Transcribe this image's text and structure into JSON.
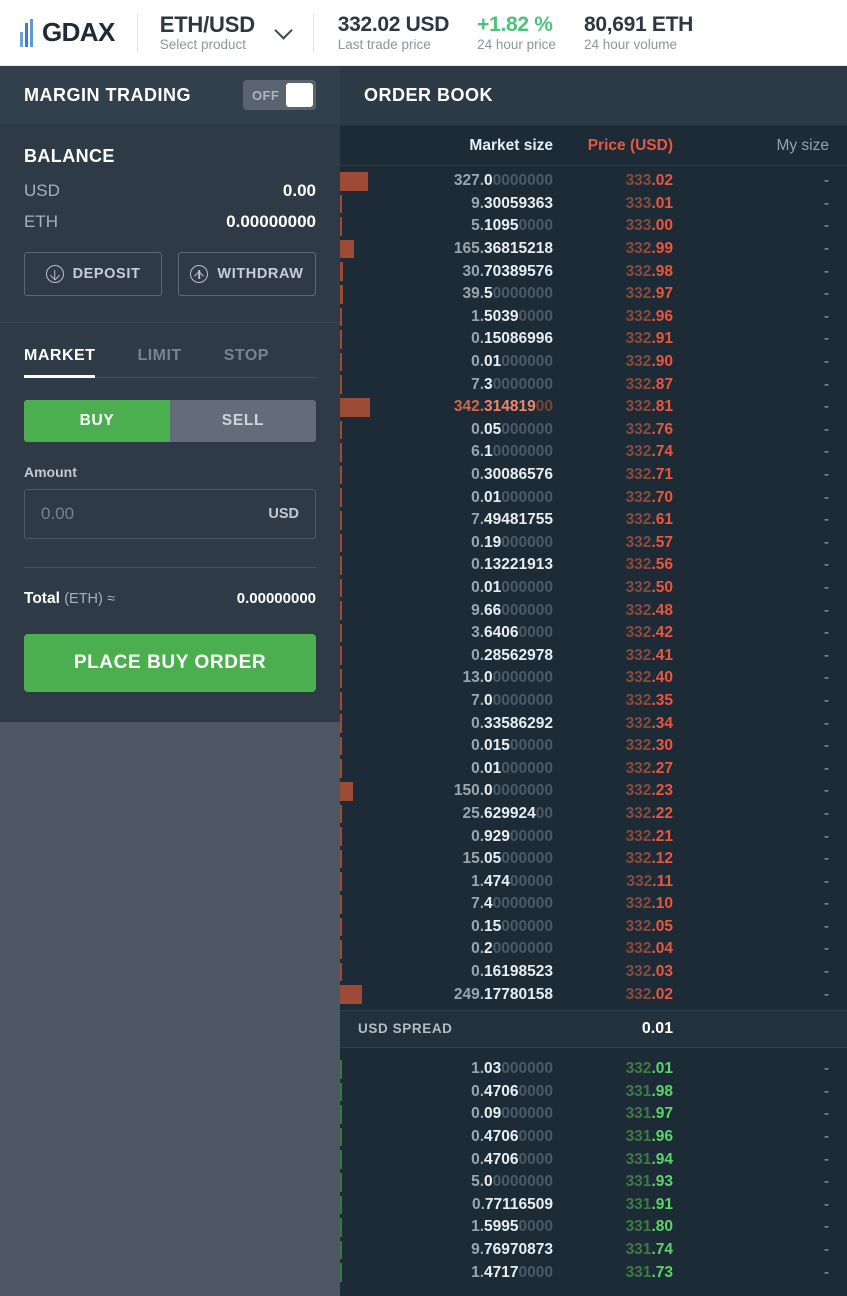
{
  "header": {
    "logo_text": "GDAX",
    "product": {
      "name": "ETH/USD",
      "sublabel": "Select product"
    },
    "stats": [
      {
        "value": "332.02 USD",
        "label": "Last trade price",
        "trend": "flat"
      },
      {
        "value": "+1.82 %",
        "label": "24 hour price",
        "trend": "up"
      },
      {
        "value": "80,691 ETH",
        "label": "24 hour volume",
        "trend": "flat"
      }
    ]
  },
  "sidebar": {
    "margin": {
      "title": "MARGIN TRADING",
      "toggle_label": "OFF",
      "toggle_state": "off"
    },
    "balance": {
      "title": "BALANCE",
      "rows": [
        {
          "currency": "USD",
          "amount": "0.00"
        },
        {
          "currency": "ETH",
          "amount": "0.00000000"
        }
      ],
      "deposit_label": "DEPOSIT",
      "withdraw_label": "WITHDRAW"
    },
    "order_form": {
      "tabs": [
        {
          "label": "MARKET",
          "active": true
        },
        {
          "label": "LIMIT",
          "active": false
        },
        {
          "label": "STOP",
          "active": false
        }
      ],
      "buy_label": "BUY",
      "sell_label": "SELL",
      "side_selected": "BUY",
      "amount_label": "Amount",
      "amount_value": "",
      "amount_placeholder": "0.00",
      "amount_unit": "USD",
      "total_label": "Total",
      "total_unit": "(ETH)",
      "total_approx": "≈",
      "total_value": "0.00000000",
      "submit_label": "PLACE BUY ORDER"
    }
  },
  "order_book": {
    "title": "ORDER BOOK",
    "columns": [
      "Market size",
      "Price (USD)",
      "My size"
    ],
    "my_size_empty": "-",
    "spread": {
      "label": "USD SPREAD",
      "value": "0.01"
    },
    "colors": {
      "ask": "#e8573f",
      "bid": "#5ed36a",
      "ask_depth": "#9d4b36",
      "bid_depth": "#2f7a3e"
    },
    "asks": [
      {
        "size": "327.00000000",
        "sig": 5,
        "price": "333.02",
        "my": "-",
        "depth": 0.131,
        "hot": false
      },
      {
        "size": "9.30059363",
        "sig": 10,
        "price": "333.01",
        "my": "-",
        "depth": 0.004,
        "hot": false
      },
      {
        "size": "5.10950000",
        "sig": 6,
        "price": "333.00",
        "my": "-",
        "depth": 0.002,
        "hot": false
      },
      {
        "size": "165.36815218",
        "sig": 12,
        "price": "332.99",
        "my": "-",
        "depth": 0.066,
        "hot": false
      },
      {
        "size": "30.70389576",
        "sig": 11,
        "price": "332.98",
        "my": "-",
        "depth": 0.013,
        "hot": false
      },
      {
        "size": "39.50000000",
        "sig": 4,
        "price": "332.97",
        "my": "-",
        "depth": 0.016,
        "hot": false
      },
      {
        "size": "1.50390000",
        "sig": 6,
        "price": "332.96",
        "my": "-",
        "depth": 0.001,
        "hot": false
      },
      {
        "size": "0.15086996",
        "sig": 10,
        "price": "332.91",
        "my": "-",
        "depth": 0.001,
        "hot": false
      },
      {
        "size": "0.01000000",
        "sig": 4,
        "price": "332.90",
        "my": "-",
        "depth": 0.001,
        "hot": false
      },
      {
        "size": "7.30000000",
        "sig": 3,
        "price": "332.87",
        "my": "-",
        "depth": 0.003,
        "hot": false
      },
      {
        "size": "342.31481900",
        "sig": 10,
        "price": "332.81",
        "my": "-",
        "depth": 0.138,
        "hot": true
      },
      {
        "size": "0.05000000",
        "sig": 4,
        "price": "332.76",
        "my": "-",
        "depth": 0.001,
        "hot": false
      },
      {
        "size": "6.10000000",
        "sig": 3,
        "price": "332.74",
        "my": "-",
        "depth": 0.003,
        "hot": false
      },
      {
        "size": "0.30086576",
        "sig": 10,
        "price": "332.71",
        "my": "-",
        "depth": 0.001,
        "hot": false
      },
      {
        "size": "0.01000000",
        "sig": 4,
        "price": "332.70",
        "my": "-",
        "depth": 0.001,
        "hot": false
      },
      {
        "size": "7.49481755",
        "sig": 10,
        "price": "332.61",
        "my": "-",
        "depth": 0.003,
        "hot": false
      },
      {
        "size": "0.19000000",
        "sig": 4,
        "price": "332.57",
        "my": "-",
        "depth": 0.001,
        "hot": false
      },
      {
        "size": "0.13221913",
        "sig": 10,
        "price": "332.56",
        "my": "-",
        "depth": 0.001,
        "hot": false
      },
      {
        "size": "0.01000000",
        "sig": 4,
        "price": "332.50",
        "my": "-",
        "depth": 0.001,
        "hot": false
      },
      {
        "size": "9.66000000",
        "sig": 4,
        "price": "332.48",
        "my": "-",
        "depth": 0.004,
        "hot": false
      },
      {
        "size": "3.64060000",
        "sig": 6,
        "price": "332.42",
        "my": "-",
        "depth": 0.002,
        "hot": false
      },
      {
        "size": "0.28562978",
        "sig": 10,
        "price": "332.41",
        "my": "-",
        "depth": 0.001,
        "hot": false
      },
      {
        "size": "13.00000000",
        "sig": 4,
        "price": "332.40",
        "my": "-",
        "depth": 0.006,
        "hot": false
      },
      {
        "size": "7.00000000",
        "sig": 3,
        "price": "332.35",
        "my": "-",
        "depth": 0.003,
        "hot": false
      },
      {
        "size": "0.33586292",
        "sig": 10,
        "price": "332.34",
        "my": "-",
        "depth": 0.001,
        "hot": false
      },
      {
        "size": "0.01500000",
        "sig": 5,
        "price": "332.30",
        "my": "-",
        "depth": 0.001,
        "hot": false
      },
      {
        "size": "0.01000000",
        "sig": 4,
        "price": "332.27",
        "my": "-",
        "depth": 0.001,
        "hot": false
      },
      {
        "size": "150.00000000",
        "sig": 5,
        "price": "332.23",
        "my": "-",
        "depth": 0.06,
        "hot": false
      },
      {
        "size": "25.62992400",
        "sig": 9,
        "price": "332.22",
        "my": "-",
        "depth": 0.011,
        "hot": false
      },
      {
        "size": "0.92900000",
        "sig": 5,
        "price": "332.21",
        "my": "-",
        "depth": 0.001,
        "hot": false
      },
      {
        "size": "15.05000000",
        "sig": 5,
        "price": "332.12",
        "my": "-",
        "depth": 0.007,
        "hot": false
      },
      {
        "size": "1.47400000",
        "sig": 5,
        "price": "332.11",
        "my": "-",
        "depth": 0.001,
        "hot": false
      },
      {
        "size": "7.40000000",
        "sig": 3,
        "price": "332.10",
        "my": "-",
        "depth": 0.003,
        "hot": false
      },
      {
        "size": "0.15000000",
        "sig": 4,
        "price": "332.05",
        "my": "-",
        "depth": 0.001,
        "hot": false
      },
      {
        "size": "0.20000000",
        "sig": 3,
        "price": "332.04",
        "my": "-",
        "depth": 0.001,
        "hot": false
      },
      {
        "size": "0.16198523",
        "sig": 10,
        "price": "332.03",
        "my": "-",
        "depth": 0.001,
        "hot": false
      },
      {
        "size": "249.17780158",
        "sig": 12,
        "price": "332.02",
        "my": "-",
        "depth": 0.1,
        "hot": false
      }
    ],
    "bids": [
      {
        "size": "1.03000000",
        "sig": 4,
        "price": "332.01",
        "my": "-",
        "depth": 0.004
      },
      {
        "size": "0.47060000",
        "sig": 6,
        "price": "331.98",
        "my": "-",
        "depth": 0.003
      },
      {
        "size": "0.09000000",
        "sig": 4,
        "price": "331.97",
        "my": "-",
        "depth": 0.003
      },
      {
        "size": "0.47060000",
        "sig": 6,
        "price": "331.96",
        "my": "-",
        "depth": 0.003
      },
      {
        "size": "0.47060000",
        "sig": 6,
        "price": "331.94",
        "my": "-",
        "depth": 0.003
      },
      {
        "size": "5.00000000",
        "sig": 3,
        "price": "331.93",
        "my": "-",
        "depth": 0.004
      },
      {
        "size": "0.77116509",
        "sig": 10,
        "price": "331.91",
        "my": "-",
        "depth": 0.003
      },
      {
        "size": "1.59950000",
        "sig": 6,
        "price": "331.80",
        "my": "-",
        "depth": 0.004
      },
      {
        "size": "9.76970873",
        "sig": 10,
        "price": "331.74",
        "my": "-",
        "depth": 0.004
      },
      {
        "size": "1.47170000",
        "sig": 6,
        "price": "331.73",
        "my": "-",
        "depth": 0.004
      }
    ]
  }
}
